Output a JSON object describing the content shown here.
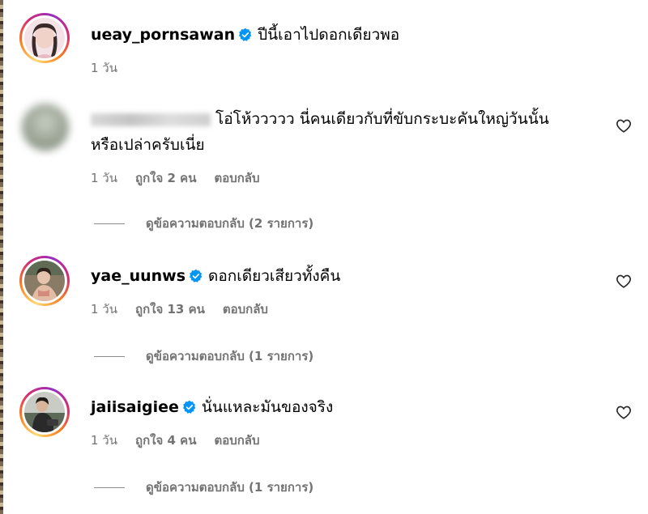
{
  "comments": [
    {
      "username": "ueay_pornsawan",
      "verified": true,
      "text": "ปีนี้เอาไปดอกเดียวพอ",
      "time": "1 วัน"
    },
    {
      "username": "",
      "verified": false,
      "text_line1": "โอ่โห้ววววว นี่คนเดียวกับที่ขับกระบะคันใหญ่วันนั้น",
      "text_line2": "หรือเปล่าครับเนี่ย",
      "time": "1 วัน",
      "likes": "ถูกใจ 2 คน",
      "reply": "ตอบกลับ",
      "view_replies": "ดูข้อความตอบกลับ (2 รายการ)"
    },
    {
      "username": "yae_uunws",
      "verified": true,
      "text": "ดอกเดียวเสียวทั้งคืน",
      "time": "1 วัน",
      "likes": "ถูกใจ 13 คน",
      "reply": "ตอบกลับ",
      "view_replies": "ดูข้อความตอบกลับ (1 รายการ)"
    },
    {
      "username": "jaiisaigiee",
      "verified": true,
      "text": "นั่นแหละมันของจริง",
      "time": "1 วัน",
      "likes": "ถูกใจ 4 คน",
      "reply": "ตอบกลับ",
      "view_replies": "ดูข้อความตอบกลับ (1 รายการ)"
    }
  ],
  "colors": {
    "verified_badge": "#0095f6",
    "meta_text": "#737373"
  },
  "icons": {
    "verified": "verified-badge-icon",
    "like": "heart-outline-icon"
  }
}
